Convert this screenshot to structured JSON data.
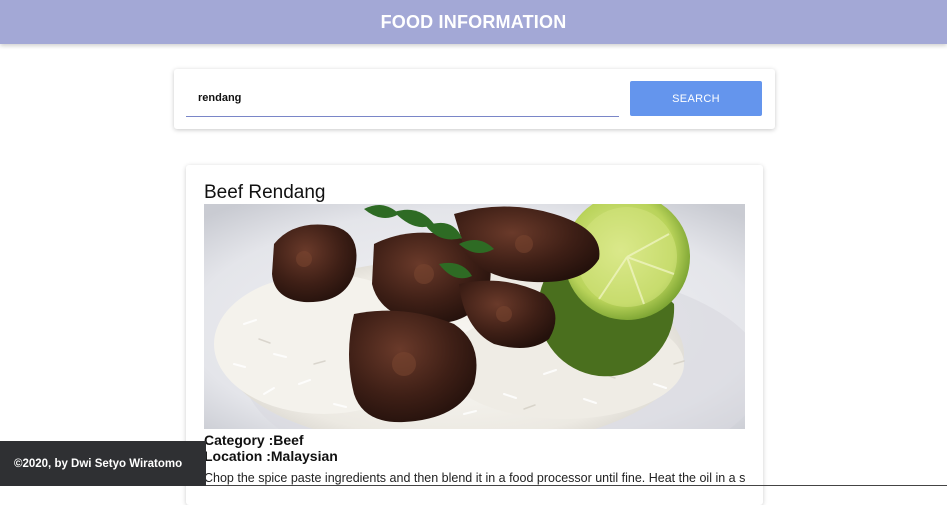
{
  "header": {
    "title": "FOOD INFORMATION"
  },
  "search": {
    "value": "rendang",
    "placeholder": "",
    "button_label": "SEARCH"
  },
  "result": {
    "name": "Beef Rendang",
    "image_alt": "beef-rendang-photo",
    "category_line": "Category :Beef",
    "location_line": "Location :Malaysian",
    "description": "Chop the spice paste ingredients and then blend it in a food processor until fine. Heat the oil in a stew"
  },
  "footer": {
    "text": "©2020, by Dwi Setyo Wiratomo"
  },
  "colors": {
    "app_bar": "#a3a8d6",
    "button": "#6495ed",
    "footer": "#2f3033"
  }
}
